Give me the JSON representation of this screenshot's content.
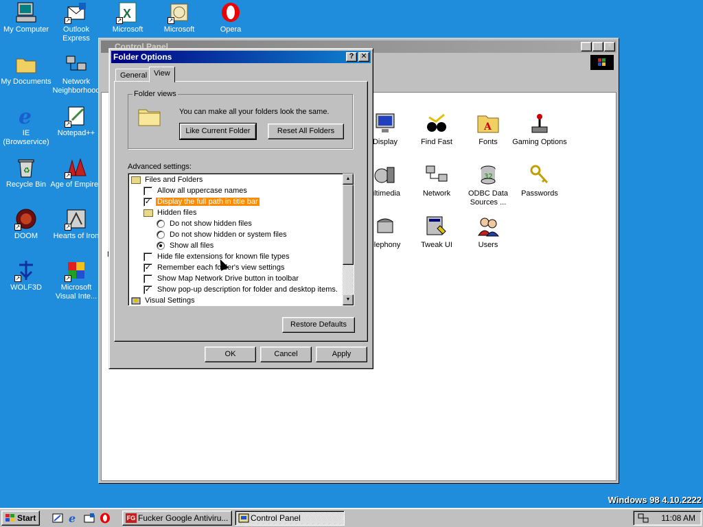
{
  "desktop": {
    "icons": [
      {
        "label": "My Computer"
      },
      {
        "label": "Outlook Express"
      },
      {
        "label": "Microsoft"
      },
      {
        "label": "Microsoft"
      },
      {
        "label": "Opera"
      },
      {
        "label": "My Documents"
      },
      {
        "label": "Network Neighborhood"
      },
      {
        "label": "IE (Browservice)"
      },
      {
        "label": "Notepad++"
      },
      {
        "label": "Recycle Bin"
      },
      {
        "label": "Age of Empires"
      },
      {
        "label": "DOOM"
      },
      {
        "label": "Hearts of Iron"
      },
      {
        "label": "WOLF3D"
      },
      {
        "label": "Microsoft Visual Inte..."
      }
    ],
    "version_text": "Windows 98 4.10.2222"
  },
  "control_panel": {
    "title": "Control Panel",
    "items": [
      {
        "label": "Display"
      },
      {
        "label": "Find Fast"
      },
      {
        "label": "Fonts"
      },
      {
        "label": "Gaming Options"
      },
      {
        "label": "ultimedia"
      },
      {
        "label": "Network"
      },
      {
        "label": "ODBC Data Sources ..."
      },
      {
        "label": "Passwords"
      },
      {
        "label": "elephony"
      },
      {
        "label": "Tweak UI"
      },
      {
        "label": "Users"
      }
    ],
    "left_letters": {
      "a": "(",
      "b": "N"
    }
  },
  "dialog": {
    "title": "Folder Options",
    "help_btn": "?",
    "close_btn": "✕",
    "tabs": [
      {
        "label": "General"
      },
      {
        "label": "View"
      }
    ],
    "folder_views": {
      "legend": "Folder views",
      "text": "You can make all your folders look the same.",
      "like_current": "Like Current Folder",
      "reset_all": "Reset All Folders"
    },
    "advanced_label": "Advanced settings:",
    "tree": [
      {
        "label": "Files and Folders"
      },
      {
        "label": "Allow all uppercase names",
        "checked": false
      },
      {
        "label": "Display the full path in title bar",
        "checked": true
      },
      {
        "label": "Hidden files"
      },
      {
        "label": "Do not show hidden files",
        "selected": false
      },
      {
        "label": "Do not show hidden or system files",
        "selected": false
      },
      {
        "label": "Show all files",
        "selected": true
      },
      {
        "label": "Hide file extensions for known file types",
        "checked": false
      },
      {
        "label": "Remember each folder's view settings",
        "checked": true
      },
      {
        "label": "Show Map Network Drive button in toolbar",
        "checked": false
      },
      {
        "label": "Show pop-up description for folder and desktop items.",
        "checked": true
      },
      {
        "label": "Visual Settings"
      }
    ],
    "restore_defaults": "Restore Defaults",
    "ok": "OK",
    "cancel": "Cancel",
    "apply": "Apply"
  },
  "taskbar": {
    "start": "Start",
    "tasks": [
      {
        "label": "Fucker Google Antiviru..."
      },
      {
        "label": "Control Panel"
      }
    ],
    "clock": "11:08 AM"
  }
}
